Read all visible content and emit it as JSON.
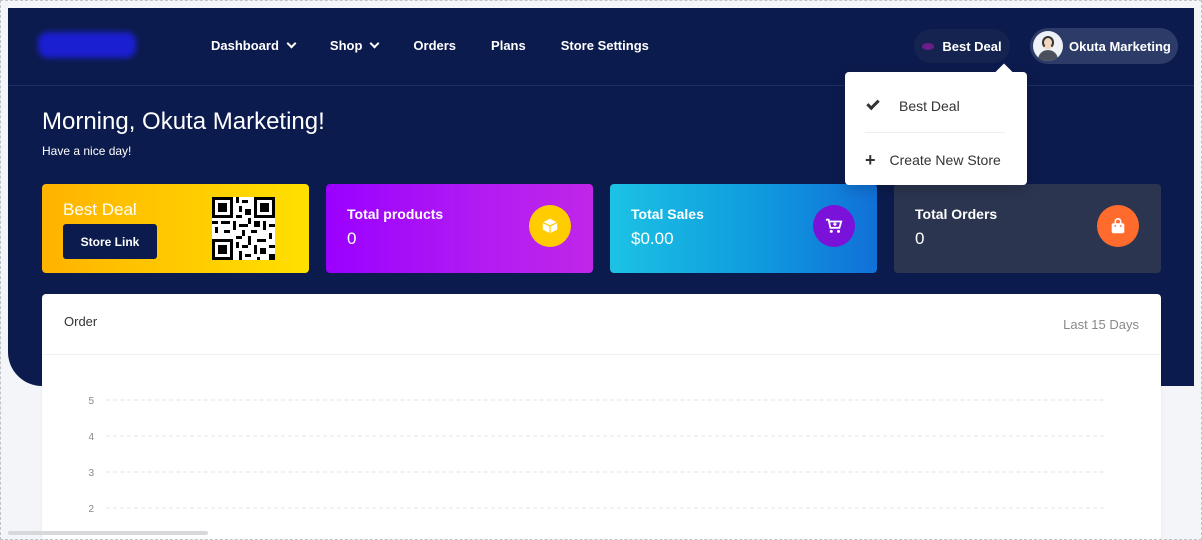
{
  "nav": {
    "items": [
      {
        "label": "Dashboard",
        "has_caret": true
      },
      {
        "label": "Shop",
        "has_caret": true
      },
      {
        "label": "Orders",
        "has_caret": false
      },
      {
        "label": "Plans",
        "has_caret": false
      },
      {
        "label": "Store Settings",
        "has_caret": false
      }
    ]
  },
  "store_switcher": {
    "label": "Best Deal"
  },
  "user": {
    "name": "Okuta Marketing"
  },
  "dropdown": {
    "items": [
      {
        "label": "Best Deal",
        "icon": "check-icon"
      },
      {
        "label": "Create New Store",
        "icon": "plus-icon"
      }
    ]
  },
  "greeting": {
    "title": "Morning, Okuta Marketing!",
    "subtitle": "Have a nice day!"
  },
  "cards": {
    "store": {
      "title": "Best Deal",
      "button": "Store Link"
    },
    "products": {
      "title": "Total products",
      "value": "0"
    },
    "sales": {
      "title": "Total Sales",
      "value": "$0.00"
    },
    "orders": {
      "title": "Total Orders",
      "value": "0"
    }
  },
  "colors": {
    "navy": "#0c1b4d",
    "yellow": "#ffcc00",
    "purple": "#b21cf2",
    "blue": "#0f9bde",
    "dark": "#2c3550",
    "orange": "#ff6b2c"
  },
  "chart_card": {
    "title": "Order",
    "range": "Last 15 Days"
  },
  "chart_data": {
    "type": "line",
    "title": "Order",
    "xlabel": "",
    "ylabel": "",
    "y_ticks": [
      "5",
      "4",
      "3",
      "2"
    ],
    "ylim": [
      0,
      5
    ],
    "grid": true,
    "series": []
  }
}
